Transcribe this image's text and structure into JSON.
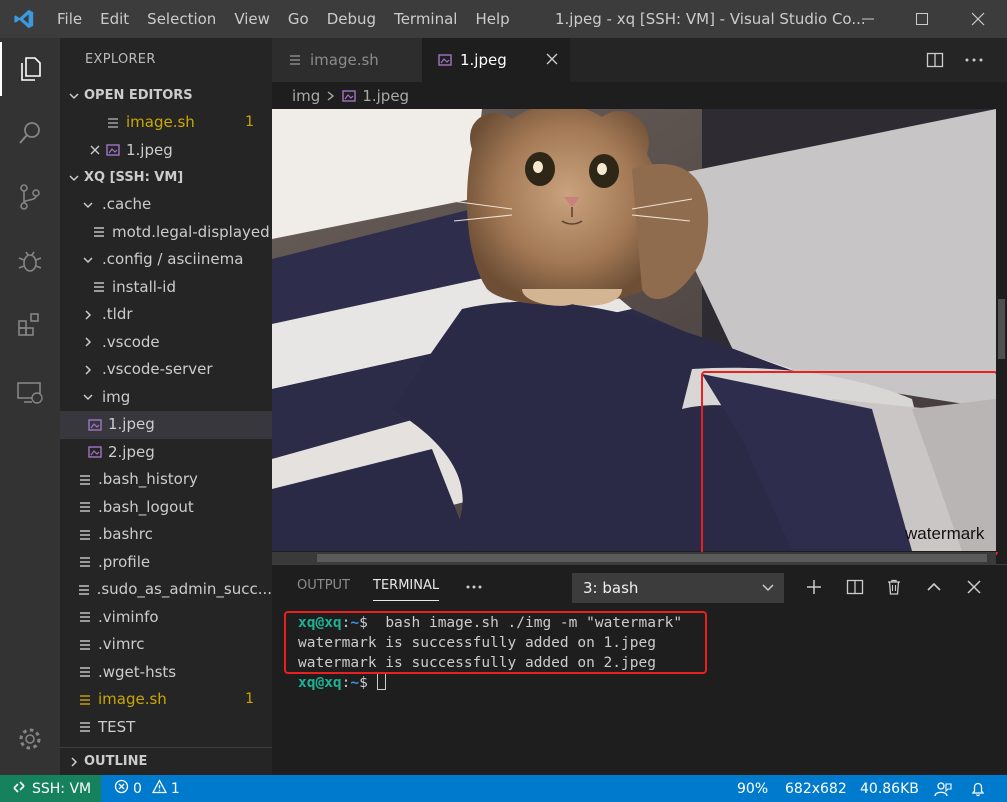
{
  "titlebar": {
    "menu": [
      "File",
      "Edit",
      "Selection",
      "View",
      "Go",
      "Debug",
      "Terminal",
      "Help"
    ],
    "title": "1.jpeg - xq [SSH: VM] - Visual Studio Co..."
  },
  "sidebar": {
    "title": "EXPLORER",
    "open_editors": {
      "header": "OPEN EDITORS",
      "items": [
        {
          "label": "image.sh",
          "badge": "1"
        },
        {
          "label": "1.jpeg"
        }
      ]
    },
    "workspace": {
      "header": "XQ [SSH: VM]",
      "items": [
        {
          "label": ".cache"
        },
        {
          "label": "motd.legal-displayed"
        },
        {
          "label": ".config / asciinema"
        },
        {
          "label": "install-id"
        },
        {
          "label": ".tldr"
        },
        {
          "label": ".vscode"
        },
        {
          "label": ".vscode-server"
        },
        {
          "label": "img"
        },
        {
          "label": "1.jpeg"
        },
        {
          "label": "2.jpeg"
        },
        {
          "label": ".bash_history"
        },
        {
          "label": ".bash_logout"
        },
        {
          "label": ".bashrc"
        },
        {
          "label": ".profile"
        },
        {
          "label": ".sudo_as_admin_succ..."
        },
        {
          "label": ".viminfo"
        },
        {
          "label": ".vimrc"
        },
        {
          "label": ".wget-hsts"
        },
        {
          "label": "image.sh",
          "badge": "1"
        },
        {
          "label": "TEST"
        }
      ]
    },
    "outline": "OUTLINE"
  },
  "tabs": [
    {
      "label": "image.sh"
    },
    {
      "label": "1.jpeg"
    }
  ],
  "breadcrumb": [
    "img",
    "1.jpeg"
  ],
  "preview": {
    "watermark_text": "watermark"
  },
  "panel": {
    "tabs": [
      "OUTPUT",
      "TERMINAL"
    ],
    "terminal_select": "3: bash",
    "terminal": {
      "user": "xq@xq",
      "path": "~",
      "command": " bash image.sh ./img -m \"watermark\"",
      "out1": "watermark is successfully added on 1.jpeg",
      "out2": "watermark is successfully added on 2.jpeg"
    }
  },
  "statusbar": {
    "remote": "SSH: VM",
    "errors": "0",
    "warnings": "1",
    "zoom": "90%",
    "dimensions": "682x682",
    "filesize": "40.86KB"
  },
  "colors": {
    "accent": "#007acc",
    "remote": "#16825d",
    "highlight": "#e82020",
    "modified": "#cca700"
  }
}
